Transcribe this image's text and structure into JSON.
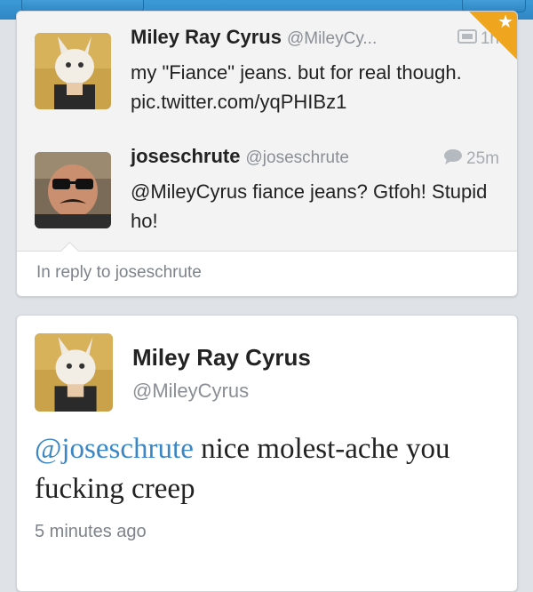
{
  "tweets": [
    {
      "name": "Miley Ray Cyrus",
      "handle": "@MileyCy...",
      "time": "1h",
      "text": "my \"Fiance\" jeans. but for real though. pic.twitter.com/yqPHIBz1",
      "icon": "photo-icon"
    },
    {
      "name": "joseschrute",
      "handle": "@joseschrute",
      "time": "25m",
      "text": "@MileyCyrus fiance jeans? Gtfoh! Stupid ho!",
      "icon": "speech-bubble-icon"
    }
  ],
  "reply_context": "In reply to joseschrute",
  "detail": {
    "name": "Miley Ray Cyrus",
    "handle": "@MileyCyrus",
    "mention": "@joseschrute",
    "text_rest": " nice molest-ache you fucking creep",
    "time_ago": "5 minutes ago"
  },
  "colors": {
    "accent": "#3b87c5",
    "favorite": "#f0a51e",
    "topbar": "#2f86c4"
  }
}
